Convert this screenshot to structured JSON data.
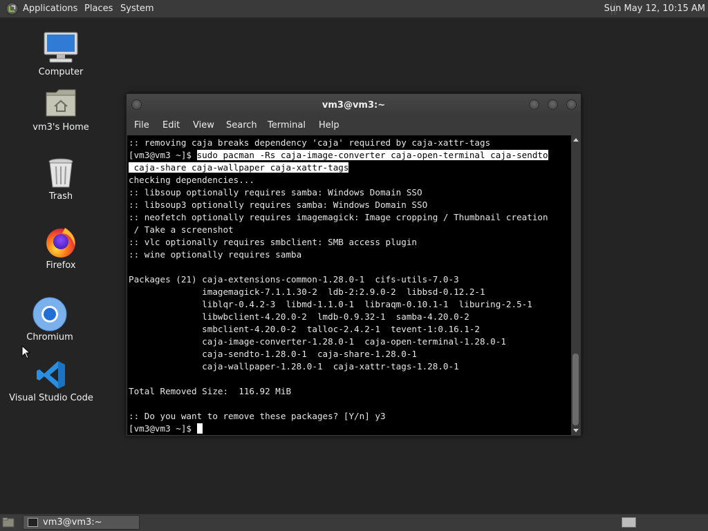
{
  "top_panel": {
    "menus": [
      "Applications",
      "Places",
      "System"
    ],
    "clock": "Sun May 12, 10:15 AM"
  },
  "desktop": {
    "icons": [
      {
        "label": "Computer",
        "icon": "computer-icon"
      },
      {
        "label": "vm3's Home",
        "icon": "home-folder-icon"
      },
      {
        "label": "Trash",
        "icon": "trash-icon"
      },
      {
        "label": "Firefox",
        "icon": "firefox-icon"
      },
      {
        "label": "Chromium",
        "icon": "chromium-icon"
      },
      {
        "label": "Visual Studio Code",
        "icon": "vscode-icon"
      }
    ]
  },
  "terminal": {
    "title": "vm3@vm3:~",
    "menu": [
      "File",
      "Edit",
      "View",
      "Search",
      "Terminal",
      "Help"
    ],
    "lines": {
      "l0": ":: removing caja breaks dependency 'caja' required by caja-xattr-tags",
      "prompt1": "[vm3@vm3 ~]$ ",
      "cmd1": "sudo pacman -Rs caja-image-converter caja-open-terminal caja-sendto",
      "cmd2": " caja-share caja-wallpaper caja-xattr-tags",
      "l3": "checking dependencies...",
      "l4": ":: libsoup optionally requires samba: Windows Domain SSO",
      "l5": ":: libsoup3 optionally requires samba: Windows Domain SSO",
      "l6": ":: neofetch optionally requires imagemagick: Image cropping / Thumbnail creation",
      "l7": " / Take a screenshot",
      "l8": ":: vlc optionally requires smbclient: SMB access plugin",
      "l9": ":: wine optionally requires samba",
      "l10": "",
      "l11": "Packages (21) caja-extensions-common-1.28.0-1  cifs-utils-7.0-3",
      "l12": "              imagemagick-7.1.1.30-2  ldb-2:2.9.0-2  libbsd-0.12.2-1",
      "l13": "              liblqr-0.4.2-3  libmd-1.1.0-1  libraqm-0.10.1-1  liburing-2.5-1",
      "l14": "              libwbclient-4.20.0-2  lmdb-0.9.32-1  samba-4.20.0-2",
      "l15": "              smbclient-4.20.0-2  talloc-2.4.2-1  tevent-1:0.16.1-2",
      "l16": "              caja-image-converter-1.28.0-1  caja-open-terminal-1.28.0-1",
      "l17": "              caja-sendto-1.28.0-1  caja-share-1.28.0-1",
      "l18": "              caja-wallpaper-1.28.0-1  caja-xattr-tags-1.28.0-1",
      "l19": "",
      "l20": "Total Removed Size:  116.92 MiB",
      "l21": "",
      "l22": ":: Do you want to remove these packages? [Y/n] y3",
      "prompt2": "[vm3@vm3 ~]$ "
    }
  },
  "taskbar": {
    "window_button": "vm3@vm3:~"
  },
  "colors": {
    "desktop_bg": "#242424",
    "panel_bg": "#3a3a3a",
    "terminal_bg": "#000000",
    "terminal_fg": "#e6e6e6"
  }
}
